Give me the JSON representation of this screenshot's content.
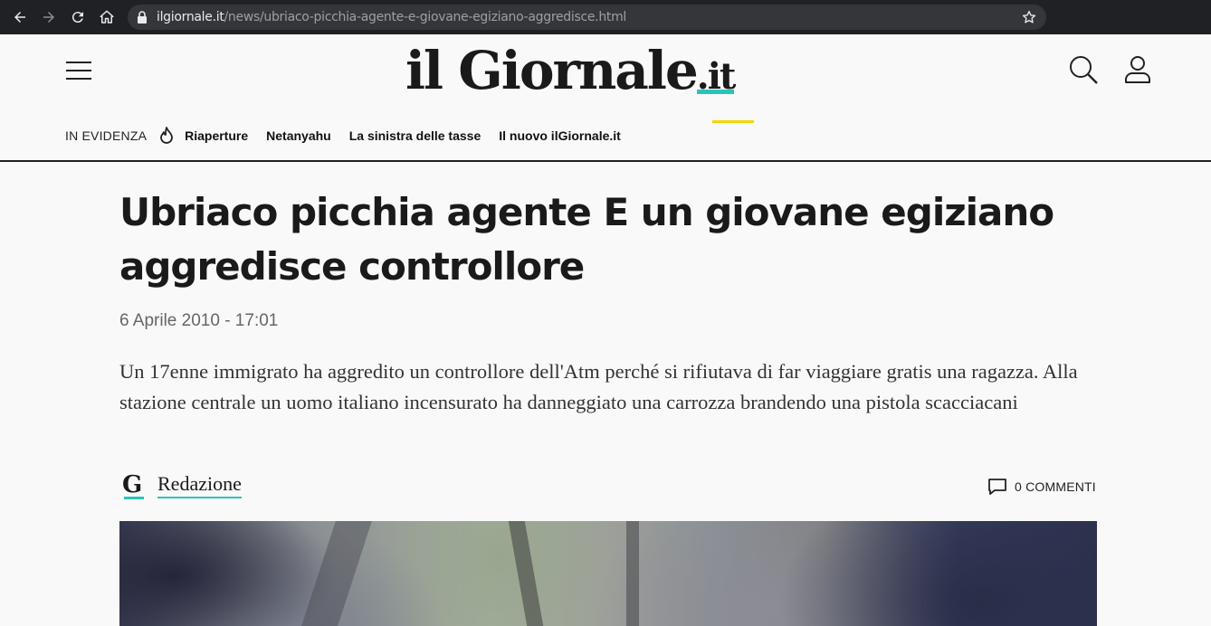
{
  "browser": {
    "url_host": "ilgiornale.it",
    "url_path": "/news/ubriaco-picchia-agente-e-giovane-egiziano-aggredisce.html"
  },
  "site": {
    "logo_main": "il Giornale",
    "logo_tld": ".it",
    "evidence_label": "IN EVIDENZA",
    "evidence_links": [
      "Riaperture",
      "Netanyahu",
      "La sinistra delle tasse",
      "Il nuovo ilGiornale.it"
    ]
  },
  "article": {
    "title": "Ubriaco picchia agente E un giovane egiziano aggredisce controllore",
    "date": "6 Aprile 2010 - 17:01",
    "lead": "Un 17enne immigrato ha aggredito un controllore dell'Atm perché si rifiutava di far viaggiare gratis una ragazza. Alla stazione centrale un uomo italiano incensurato ha danneggiato una carrozza brandendo una pistola scacciacani",
    "author_initial": "G",
    "author": "Redazione",
    "comments": "0 COMMENTI"
  },
  "colors": {
    "accent_teal": "#2ac4b7",
    "accent_yellow": "#f2d600",
    "chrome_bg": "#202124"
  },
  "icons": [
    "back-icon",
    "forward-icon",
    "reload-icon",
    "home-icon",
    "lock-icon",
    "star-icon",
    "menu-icon",
    "search-icon",
    "user-icon",
    "flame-icon",
    "comment-icon"
  ]
}
